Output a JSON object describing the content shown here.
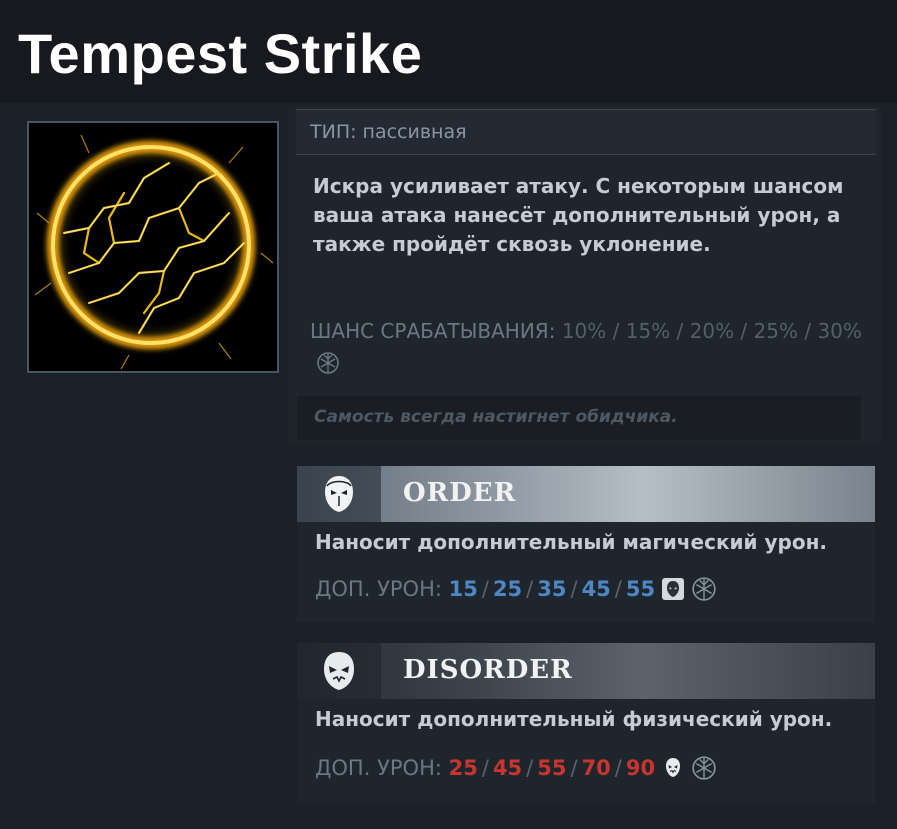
{
  "title": "Tempest Strike",
  "ability": {
    "type_line": "ТИП: пассивная",
    "description": "Искра усиливает атаку. С некоторым шансом ваша атака нанесёт дополнительный урон, а также пройдёт сквозь уклонение.",
    "chance_label": "ШАНС СРАБАТЫВАНИЯ:",
    "chance_values": "10% / 15% / 20% / 25% / 30%",
    "lore": "Самость всегда настигнет обидчика."
  },
  "facets": [
    {
      "name": "ORDER",
      "description": "Наносит дополнительный магический урон.",
      "damage_label": "ДОП. УРОН:",
      "values": [
        "15",
        "25",
        "35",
        "45",
        "55"
      ],
      "value_color": "#4f86c4",
      "icon": "order-mask-icon"
    },
    {
      "name": "DISORDER",
      "description": "Наносит дополнительный физический урон.",
      "damage_label": "ДОП. УРОН:",
      "values": [
        "25",
        "45",
        "55",
        "70",
        "90"
      ],
      "value_color": "#c7352e",
      "icon": "disorder-mask-icon"
    }
  ],
  "colors": {
    "background": "#1c2129",
    "title_bar": "#17191e",
    "order_values": "#4f86c4",
    "disorder_values": "#c7352e",
    "lightning": "#f5c518"
  },
  "icons": {
    "ability": "lightning-orb-icon",
    "scepter": "aghanims-scepter-icon"
  }
}
